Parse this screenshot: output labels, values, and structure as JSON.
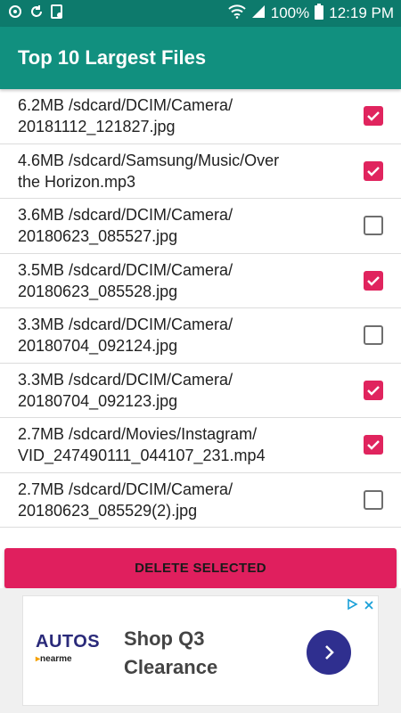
{
  "status_bar": {
    "battery": "100%",
    "time": "12:19 PM"
  },
  "app_bar": {
    "title": "Top 10 Largest Files"
  },
  "files": [
    {
      "line1": "6.2MB /sdcard/DCIM/Camera/",
      "line2": "20181112_121827.jpg",
      "checked": true
    },
    {
      "line1": "4.6MB /sdcard/Samsung/Music/Over",
      "line2": "the Horizon.mp3",
      "checked": true
    },
    {
      "line1": "3.6MB /sdcard/DCIM/Camera/",
      "line2": "20180623_085527.jpg",
      "checked": false
    },
    {
      "line1": "3.5MB /sdcard/DCIM/Camera/",
      "line2": "20180623_085528.jpg",
      "checked": true
    },
    {
      "line1": "3.3MB /sdcard/DCIM/Camera/",
      "line2": "20180704_092124.jpg",
      "checked": false
    },
    {
      "line1": "3.3MB /sdcard/DCIM/Camera/",
      "line2": "20180704_092123.jpg",
      "checked": true
    },
    {
      "line1": "2.7MB /sdcard/Movies/Instagram/",
      "line2": "VID_247490111_044107_231.mp4",
      "checked": true
    },
    {
      "line1": "2.7MB /sdcard/DCIM/Camera/",
      "line2": "20180623_085529(2).jpg",
      "checked": false
    }
  ],
  "delete_button": {
    "label": "DELETE SELECTED"
  },
  "ad": {
    "logo_main": "AUTOS",
    "logo_sub": "nearme",
    "headline_line1": "Shop Q3",
    "headline_line2": "Clearance"
  },
  "colors": {
    "status_bar": "#0d7a6c",
    "app_bar": "#11907f",
    "accent": "#e0245e"
  }
}
